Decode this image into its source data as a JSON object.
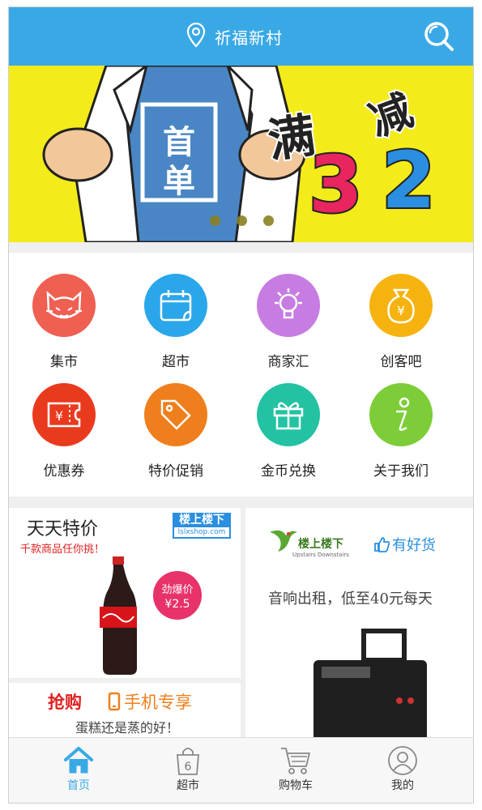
{
  "header": {
    "location": "祈福新村",
    "location_icon": "map-pin-icon",
    "search_icon": "search-icon"
  },
  "banner": {
    "badge_text": "首单",
    "promo_text": "满减",
    "num1": "3",
    "num2": "2",
    "carousel_count": 3,
    "active_index": 0
  },
  "grid": {
    "items": [
      {
        "label": "集市",
        "icon": "cat-icon",
        "color": "#ef5f52"
      },
      {
        "label": "超市",
        "icon": "calendar-icon",
        "color": "#2aa7ea"
      },
      {
        "label": "商家汇",
        "icon": "lightbulb-icon",
        "color": "#c77ce2"
      },
      {
        "label": "创客吧",
        "icon": "money-bag-icon",
        "color": "#f6b310"
      },
      {
        "label": "优惠券",
        "icon": "coupon-icon",
        "color": "#ea3a1e"
      },
      {
        "label": "特价促销",
        "icon": "tag-icon",
        "color": "#ef7f1c"
      },
      {
        "label": "金币兑换",
        "icon": "gift-icon",
        "color": "#23c2a2"
      },
      {
        "label": "关于我们",
        "icon": "info-icon",
        "color": "#7ccd37"
      }
    ]
  },
  "cards": {
    "daily_deal": {
      "title": "天天特价",
      "subtitle": "千款商品任你挑！",
      "brand_line1": "楼上楼下",
      "brand_line2": "lslxshop.com",
      "badge_line1": "劲爆价",
      "badge_line2": "¥2.5"
    },
    "recommend": {
      "brand_line1": "楼上楼下",
      "brand_line2": "Upstairs Downstairs",
      "good_label": "有好货",
      "desc": "音响出租，低至40元每天"
    },
    "flash": {
      "title": "抢购",
      "mobile_label": "手机专享",
      "desc": "蛋糕还是蒸的好！"
    }
  },
  "tabbar": {
    "items": [
      {
        "label": "首页",
        "icon": "home-icon",
        "active": true
      },
      {
        "label": "超市",
        "icon": "shopping-bag-icon",
        "active": false,
        "badge": "6"
      },
      {
        "label": "购物车",
        "icon": "cart-icon",
        "active": false
      },
      {
        "label": "我的",
        "icon": "user-icon",
        "active": false
      }
    ]
  },
  "colors": {
    "primary": "#39a9e6",
    "banner_bg": "#f4eb1b",
    "promo_pink": "#e8255e",
    "promo_blue": "#2a8fe0",
    "deal_red": "#e02020",
    "badge_pink": "#e8326a"
  }
}
